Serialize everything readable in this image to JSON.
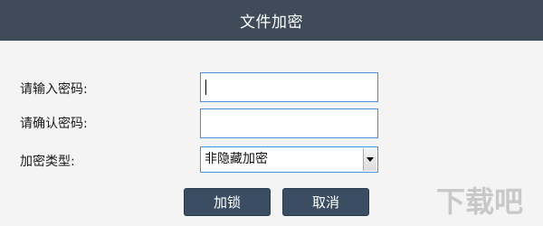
{
  "window": {
    "title": "文件加密"
  },
  "form": {
    "password_label": "请输入密码:",
    "confirm_label": "请确认密码:",
    "type_label": "加密类型:",
    "password_value": "",
    "confirm_value": "",
    "type_selected": "非隐藏加密"
  },
  "buttons": {
    "lock_label": "加锁",
    "cancel_label": "取消"
  },
  "colors": {
    "titlebar": "#3f4b59",
    "button": "#3a4d63",
    "input_border": "#4a90d9"
  },
  "watermark": {
    "text": "下载吧"
  }
}
